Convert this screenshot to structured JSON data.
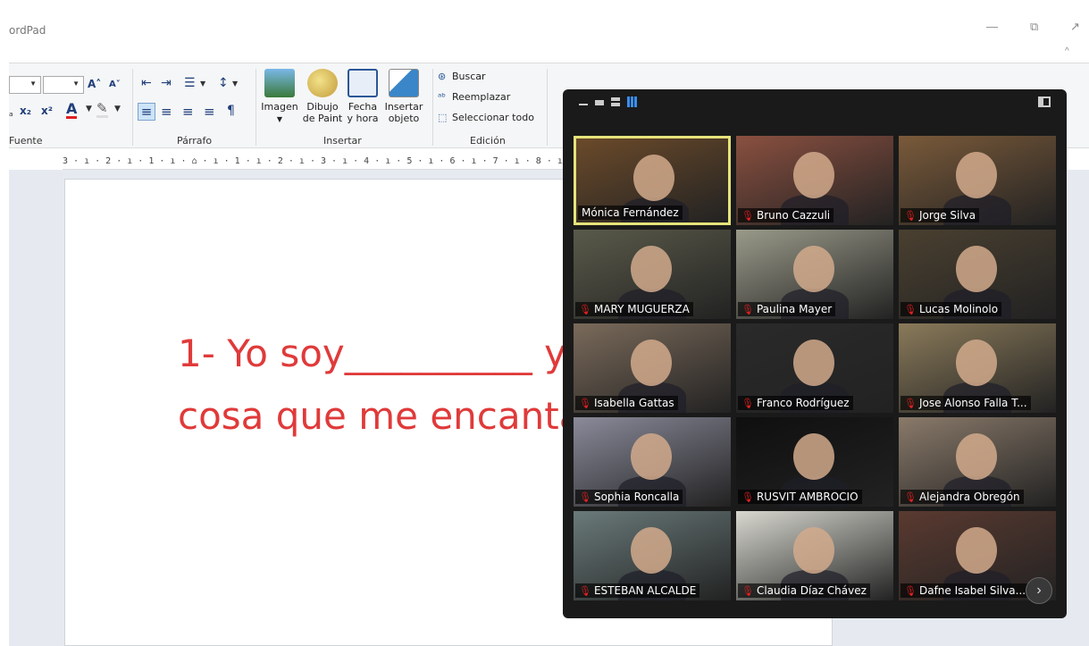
{
  "window": {
    "title": "ordPad",
    "minimize_glyph": "—",
    "restore_glyph": "⧉",
    "close_glyph": "↗",
    "collapse_glyph": "^"
  },
  "ribbon": {
    "groups": {
      "fuente": "Fuente",
      "parrafo": "Párrafo",
      "insertar": "Insertar",
      "edicion": "Edición"
    },
    "font": {
      "grow_glyph": "A˄",
      "shrink_glyph": "A˅",
      "subscript": "x₂",
      "superscript": "x²",
      "color_glyph": "A",
      "highlight_glyph": "✎"
    },
    "paragraph": {
      "outdent": "⇤",
      "indent": "⇥",
      "bullets": "☰",
      "spacing": "↕",
      "align_left": "≡",
      "align_center": "≡",
      "align_right": "≡",
      "justify": "≡",
      "para_mark": "¶"
    },
    "insert": {
      "imagen": "Imagen",
      "dibujo_line1": "Dibujo",
      "dibujo_line2": "de Paint",
      "fecha_line1": "Fecha",
      "fecha_line2": "y hora",
      "objeto_line1": "Insertar",
      "objeto_line2": "objeto"
    },
    "edit": {
      "buscar": "Buscar",
      "reemplazar": "Reemplazar",
      "seleccionar": "Seleccionar todo"
    }
  },
  "ruler": {
    "text": "3 · ı · 2 · ı · 1 · ı · ⌂ · ı · 1 · ı · 2 · ı · 3 · ı · 4 · ı · 5 · ı · 6 · ı · 7 · ı · 8 · ı · 9 · ı · 10 · ı"
  },
  "document": {
    "line1": "1- Yo soy__________ y",
    "line2": "cosa que me encanta"
  },
  "zoom": {
    "participants": [
      {
        "name": "Mónica Fernández",
        "muted": false,
        "bg": "#6b4a2a"
      },
      {
        "name": "Bruno Cazzuli",
        "muted": true,
        "bg": "#8a5040"
      },
      {
        "name": "Jorge Silva",
        "muted": true,
        "bg": "#7a5a3a"
      },
      {
        "name": "MARY MUGUERZA",
        "muted": true,
        "bg": "#5a5a4a"
      },
      {
        "name": "Paulina Mayer",
        "muted": true,
        "bg": "#9a9a8a"
      },
      {
        "name": "Lucas Molinolo",
        "muted": true,
        "bg": "#4a4030"
      },
      {
        "name": "Isabella Gattas",
        "muted": true,
        "bg": "#7a6a5a"
      },
      {
        "name": "Franco Rodríguez",
        "muted": true,
        "bg": "#2a2a2a"
      },
      {
        "name": "Jose Alonso Falla T...",
        "muted": true,
        "bg": "#8a7a5a"
      },
      {
        "name": "Sophia Roncalla",
        "muted": true,
        "bg": "#8a8a9a"
      },
      {
        "name": "RUSVIT AMBROCIO",
        "muted": true,
        "bg": "#0f0f0f"
      },
      {
        "name": "Alejandra Obregón",
        "muted": true,
        "bg": "#8a7a6a"
      },
      {
        "name": "ESTEBAN ALCALDE",
        "muted": true,
        "bg": "#6a7a7a"
      },
      {
        "name": "Claudia Díaz Chávez",
        "muted": true,
        "bg": "#d8d8d0"
      },
      {
        "name": "Dafne Isabel Silva...",
        "muted": true,
        "bg": "#5a3a30"
      }
    ],
    "next_glyph": "›",
    "mic_glyph": "🎙",
    "colors": {
      "active_border": "#e6e37a",
      "muted_mic": "#e02020"
    }
  }
}
